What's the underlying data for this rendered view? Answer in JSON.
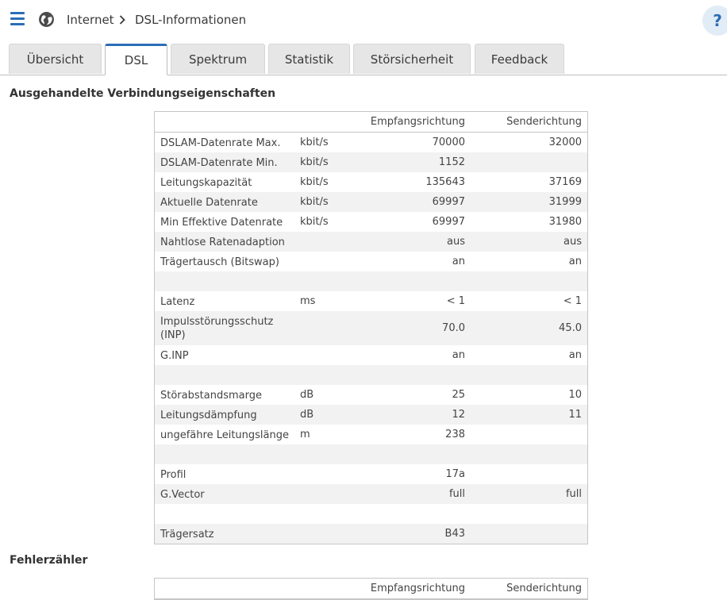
{
  "breadcrumb": {
    "section": "Internet",
    "page": "DSL-Informationen"
  },
  "help": {
    "label": "?"
  },
  "tabs": [
    "Übersicht",
    "DSL",
    "Spektrum",
    "Statistik",
    "Störsicherheit",
    "Feedback"
  ],
  "active_tab": "DSL",
  "connection": {
    "title": "Ausgehandelte Verbindungseigenschaften",
    "header": {
      "rx": "Empfangsrichtung",
      "tx": "Senderichtung"
    },
    "rows": [
      {
        "label": "DSLAM-Datenrate Max.",
        "unit": "kbit/s",
        "rx": "70000",
        "tx": "32000"
      },
      {
        "label": "DSLAM-Datenrate Min.",
        "unit": "kbit/s",
        "rx": "1152",
        "tx": ""
      },
      {
        "label": "Leitungskapazität",
        "unit": "kbit/s",
        "rx": "135643",
        "tx": "37169"
      },
      {
        "label": "Aktuelle Datenrate",
        "unit": "kbit/s",
        "rx": "69997",
        "tx": "31999"
      },
      {
        "label": "Min Effektive Datenrate",
        "unit": "kbit/s",
        "rx": "69997",
        "tx": "31980"
      },
      {
        "label": "Nahtlose Ratenadaption",
        "unit": "",
        "rx": "aus",
        "tx": "aus"
      },
      {
        "label": "Trägertausch (Bitswap)",
        "unit": "",
        "rx": "an",
        "tx": "an"
      },
      {
        "label": "",
        "unit": "",
        "rx": "",
        "tx": ""
      },
      {
        "label": "Latenz",
        "unit": "ms",
        "rx": "< 1",
        "tx": "< 1"
      },
      {
        "label": "Impulsstörungsschutz (INP)",
        "unit": "",
        "rx": "70.0",
        "tx": "45.0"
      },
      {
        "label": "G.INP",
        "unit": "",
        "rx": "an",
        "tx": "an"
      },
      {
        "label": "",
        "unit": "",
        "rx": "",
        "tx": ""
      },
      {
        "label": "Störabstandsmarge",
        "unit": "dB",
        "rx": "25",
        "tx": "10"
      },
      {
        "label": "Leitungsdämpfung",
        "unit": "dB",
        "rx": "12",
        "tx": "11"
      },
      {
        "label": "ungefähre Leitungslänge",
        "unit": "m",
        "rx": "238",
        "tx": ""
      },
      {
        "label": "",
        "unit": "",
        "rx": "",
        "tx": ""
      },
      {
        "label": "Profil",
        "unit": "",
        "rx": "17a",
        "tx": ""
      },
      {
        "label": "G.Vector",
        "unit": "",
        "rx": "full",
        "tx": "full"
      },
      {
        "label": "",
        "unit": "",
        "rx": "",
        "tx": ""
      },
      {
        "label": "Trägersatz",
        "unit": "",
        "rx": "B43",
        "tx": ""
      }
    ]
  },
  "errors": {
    "title": "Fehlerzähler",
    "header": {
      "rx": "Empfangsrichtung",
      "tx": "Senderichtung"
    }
  },
  "colors": {
    "accent": "#2b6db5",
    "row_shade": "#f2f2f2",
    "tab_bg": "#e6e6e6"
  },
  "icons": {
    "menu": "hamburger-menu-icon",
    "globe": "globe-icon",
    "separator": "chevron-right-icon"
  }
}
